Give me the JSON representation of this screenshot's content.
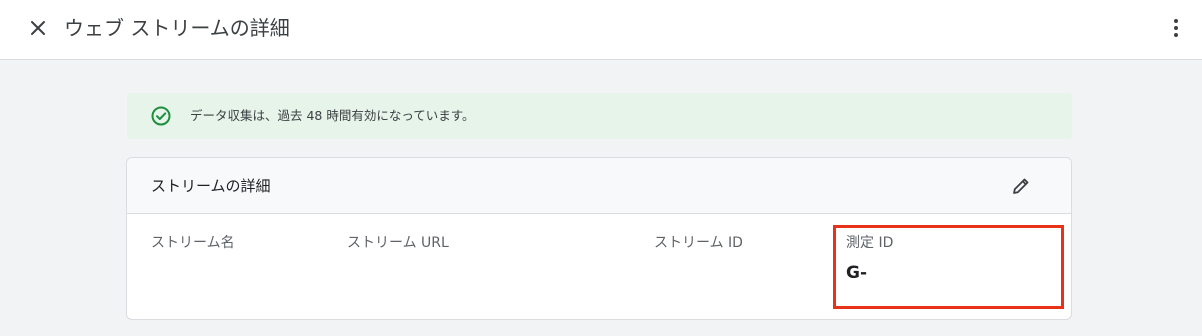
{
  "header": {
    "title": "ウェブ ストリームの詳細",
    "close_icon": "close-icon",
    "menu_icon": "more-vert-icon"
  },
  "banner": {
    "text": "データ収集は、過去 48 時間有効になっています。",
    "icon": "check-circle-icon",
    "color": "#1e8e3e"
  },
  "card": {
    "title": "ストリームの詳細",
    "edit_icon": "pencil-icon",
    "fields": [
      {
        "label": "ストリーム名",
        "value": ""
      },
      {
        "label": "ストリーム URL",
        "value": ""
      },
      {
        "label": "ストリーム ID",
        "value": ""
      },
      {
        "label": "測定 ID",
        "value": "G-"
      }
    ]
  },
  "colors": {
    "highlight": "#e8331a",
    "banner_bg": "#e6f4ea"
  }
}
